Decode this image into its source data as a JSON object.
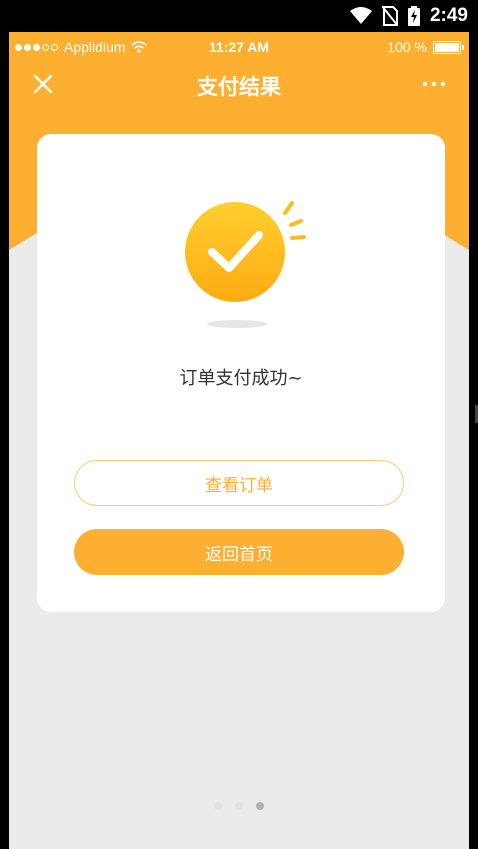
{
  "system_bar": {
    "time": "2:49",
    "icons": [
      "wifi-icon",
      "no-sim-icon",
      "battery-charging-icon"
    ]
  },
  "ios_status": {
    "carrier": "Applidium",
    "time": "11:27 AM",
    "battery": "100 %"
  },
  "navbar": {
    "title": "支付结果",
    "left_icon": "close-icon",
    "right_icon": "more-icon"
  },
  "result": {
    "icon": "success-check-icon",
    "message": "订单支付成功~"
  },
  "buttons": {
    "view_order": "查看订单",
    "back_home": "返回首页"
  },
  "pager": {
    "count": 3,
    "active_index": 2
  },
  "colors": {
    "accent": "#fdaf31",
    "background": "#ebebeb",
    "card": "#ffffff",
    "text": "#333333"
  }
}
